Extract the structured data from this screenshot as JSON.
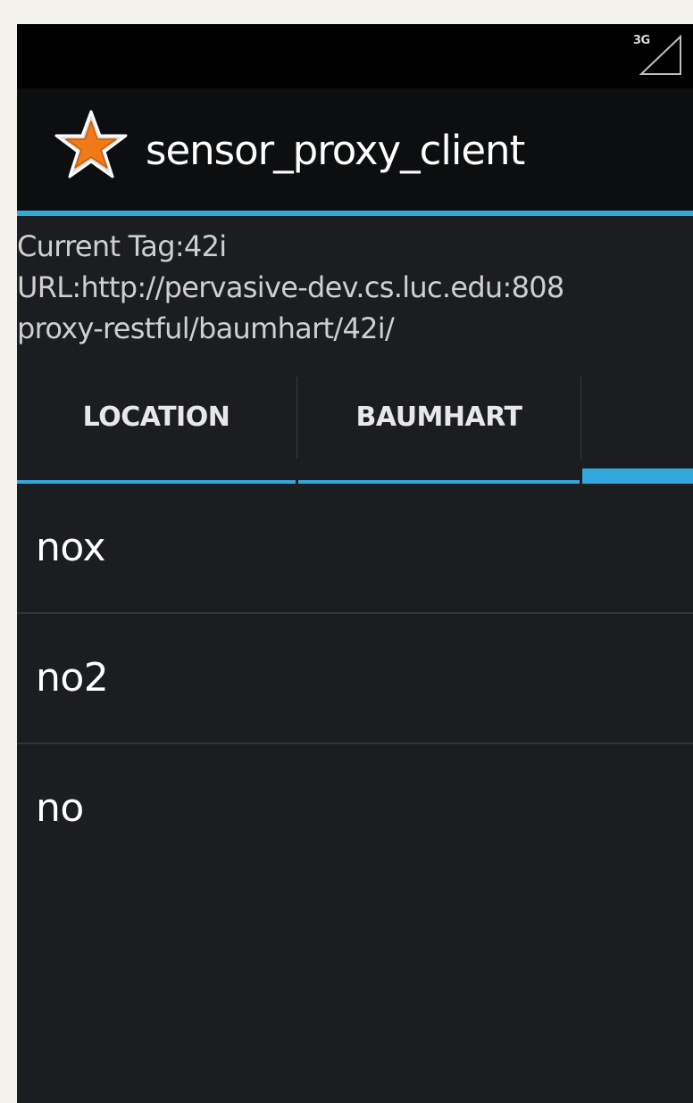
{
  "status_bar": {
    "network_label": "3G",
    "signal_icon": "signal-triangle-icon"
  },
  "action_bar": {
    "title": "sensor_proxy_client",
    "app_icon": "star-icon",
    "accent_color": "#32a8dc",
    "icon_color": "#f07a16"
  },
  "info": {
    "current_tag": "Current Tag:42i",
    "url_line1": "URL:http://pervasive-dev.cs.luc.edu:808",
    "url_line2": "proxy-restful/baumhart/42i/"
  },
  "tabs": [
    {
      "label": "LOCATION",
      "selected": false
    },
    {
      "label": "BAUMHART",
      "selected": false
    },
    {
      "label": "",
      "selected": true
    }
  ],
  "list": {
    "items": [
      {
        "label": "nox"
      },
      {
        "label": "no2"
      },
      {
        "label": "no"
      }
    ]
  }
}
